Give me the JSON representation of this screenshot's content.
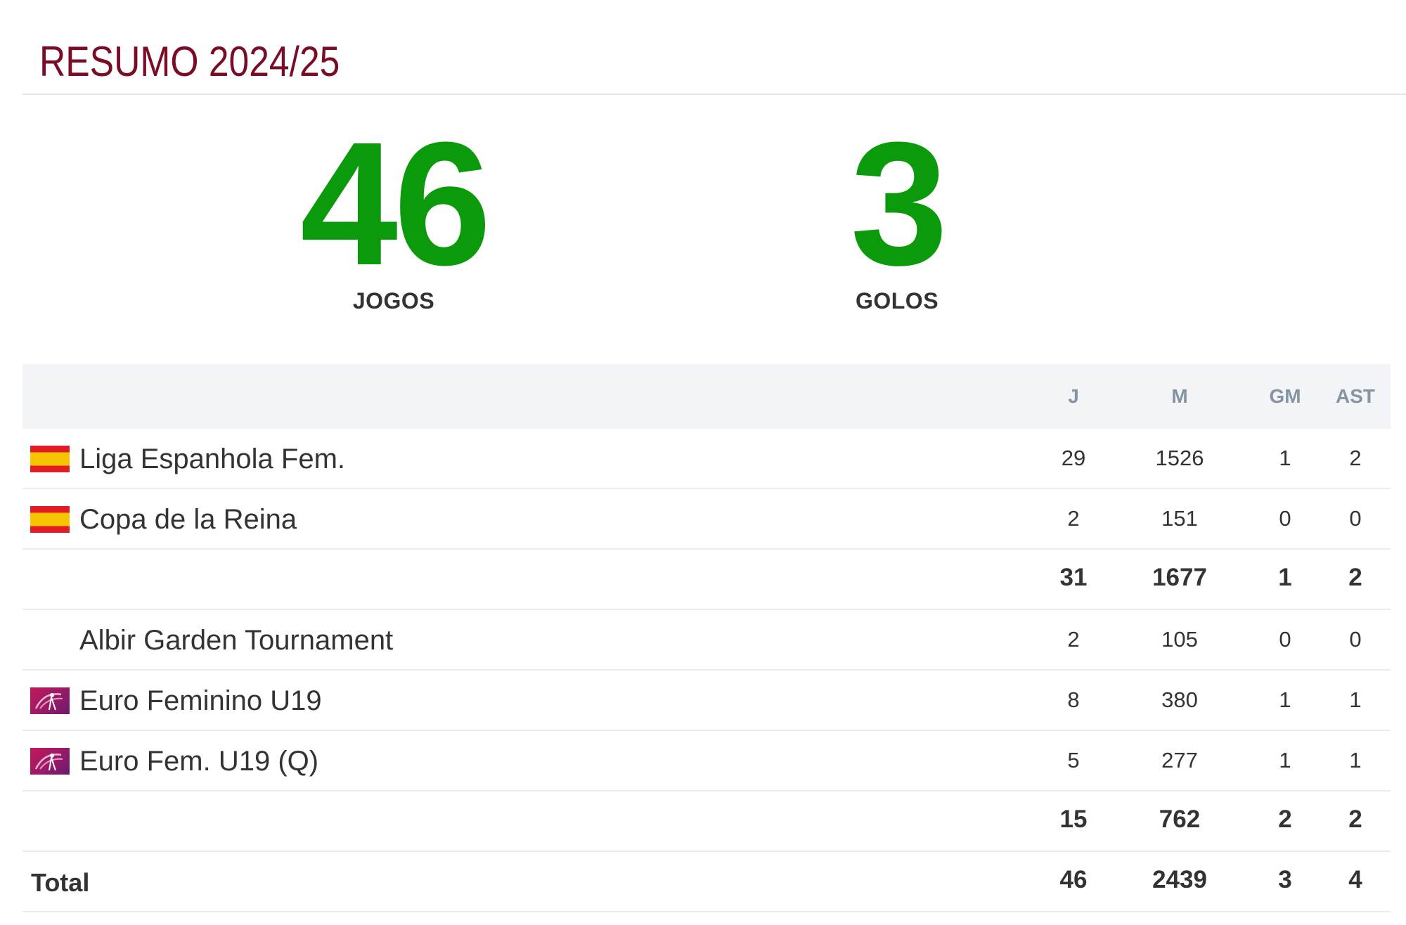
{
  "header": {
    "title": "RESUMO 2024/25"
  },
  "summary": {
    "games_value": "46",
    "games_label": "JOGOS",
    "goals_value": "3",
    "goals_label": "GOLOS"
  },
  "table": {
    "columns": {
      "j": "J",
      "m": "M",
      "gm": "GM",
      "ast": "AST"
    },
    "rows": [
      {
        "name": "Liga Espanhola Fem.",
        "icon": "spain-flag-icon",
        "j": "29",
        "m": "1526",
        "gm": "1",
        "ast": "2"
      },
      {
        "name": "Copa de la Reina",
        "icon": "spain-flag-icon",
        "j": "2",
        "m": "151",
        "gm": "0",
        "ast": "0"
      },
      {
        "name": "",
        "subtotal": true,
        "j": "31",
        "m": "1677",
        "gm": "1",
        "ast": "2"
      },
      {
        "name": "Albir Garden Tournament",
        "icon": "",
        "j": "2",
        "m": "105",
        "gm": "0",
        "ast": "0"
      },
      {
        "name": "Euro Feminino U19",
        "icon": "uefa-women-u19-logo-icon",
        "j": "8",
        "m": "380",
        "gm": "1",
        "ast": "1"
      },
      {
        "name": "Euro Fem. U19 (Q)",
        "icon": "uefa-women-u19-logo-icon",
        "j": "5",
        "m": "277",
        "gm": "1",
        "ast": "1"
      },
      {
        "name": "",
        "subtotal": true,
        "j": "15",
        "m": "762",
        "gm": "2",
        "ast": "2"
      }
    ],
    "total": {
      "name": "Total",
      "j": "46",
      "m": "2439",
      "gm": "3",
      "ast": "4"
    }
  },
  "colors": {
    "title": "#7b0c25",
    "stat_value": "#0b9a0b",
    "header_bg": "#f2f4f8",
    "header_text": "#8693a3"
  }
}
